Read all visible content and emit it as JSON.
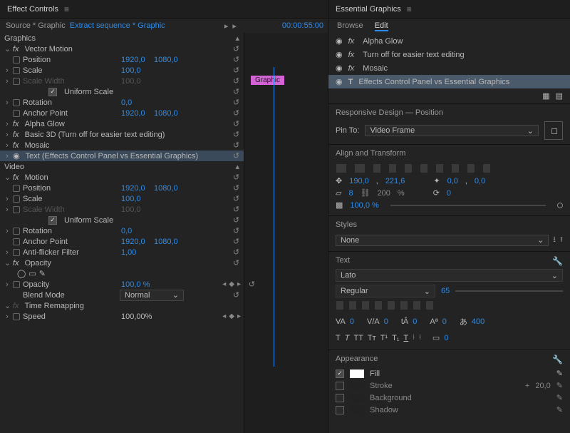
{
  "left": {
    "panel_title": "Effect Controls",
    "source_label": "Source * Graphic",
    "sequence_label": "Extract sequence * Graphic",
    "timecode": "00:00:55:00",
    "clip_label": "Graphic",
    "sections": {
      "graphics": "Graphics",
      "vector_motion": "Vector Motion",
      "position": "Position",
      "scale": "Scale",
      "scale_width": "Scale Width",
      "uniform_scale": "Uniform Scale",
      "rotation": "Rotation",
      "anchor_point": "Anchor Point",
      "alpha_glow": "Alpha Glow",
      "basic3d": "Basic 3D (Turn off for easier text editing)",
      "mosaic": "Mosaic",
      "text_layer": "Text (Effects Control Panel vs Essential Graphics)",
      "video": "Video",
      "motion": "Motion",
      "antiflicker": "Anti-flicker Filter",
      "opacity": "Opacity",
      "opacity_prop": "Opacity",
      "blend_mode": "Blend Mode",
      "time_remap": "Time Remapping",
      "speed": "Speed"
    },
    "values": {
      "vm_position_x": "1920,0",
      "vm_position_y": "1080,0",
      "vm_scale": "100,0",
      "vm_scale_w": "100,0",
      "vm_rotation": "0,0",
      "vm_anchor_x": "1920,0",
      "vm_anchor_y": "1080,0",
      "m_position_x": "1920,0",
      "m_position_y": "1080,0",
      "m_scale": "100,0",
      "m_scale_w": "100,0",
      "m_rotation": "0,0",
      "m_anchor_x": "1920,0",
      "m_anchor_y": "1080,0",
      "antiflicker": "1,00",
      "opacity": "100,0 %",
      "blend_mode": "Normal",
      "speed": "100,00%"
    }
  },
  "right": {
    "panel_title": "Essential Graphics",
    "tab_browse": "Browse",
    "tab_edit": "Edit",
    "layers": [
      {
        "icon": "fx",
        "label": "Alpha Glow"
      },
      {
        "icon": "fx",
        "label": "Turn off for easier text editing"
      },
      {
        "icon": "fx",
        "label": "Mosaic"
      },
      {
        "icon": "T",
        "label": "Effects Control Panel vs Essential Graphics",
        "selected": true
      }
    ],
    "responsive": {
      "title": "Responsive Design — Position",
      "pin_label": "Pin To:",
      "pin_value": "Video Frame"
    },
    "align_title": "Align and Transform",
    "transform": {
      "pos_x": "190,0",
      "pos_y": "221,6",
      "scale": "0,0",
      "w": "8",
      "h": "200",
      "ratio": "%",
      "rotation": "0",
      "opacity": "100,0 %"
    },
    "styles": {
      "title": "Styles",
      "value": "None"
    },
    "text": {
      "title": "Text",
      "font": "Lato",
      "weight": "Regular",
      "size": "65",
      "tracking": "0",
      "tracking2": "0",
      "baseline": "0",
      "leading": "0",
      "tsume": "400",
      "stroke_w": "0"
    },
    "appearance": {
      "title": "Appearance",
      "fill": "Fill",
      "stroke": "Stroke",
      "stroke_val": "20,0",
      "background": "Background",
      "shadow": "Shadow"
    }
  }
}
